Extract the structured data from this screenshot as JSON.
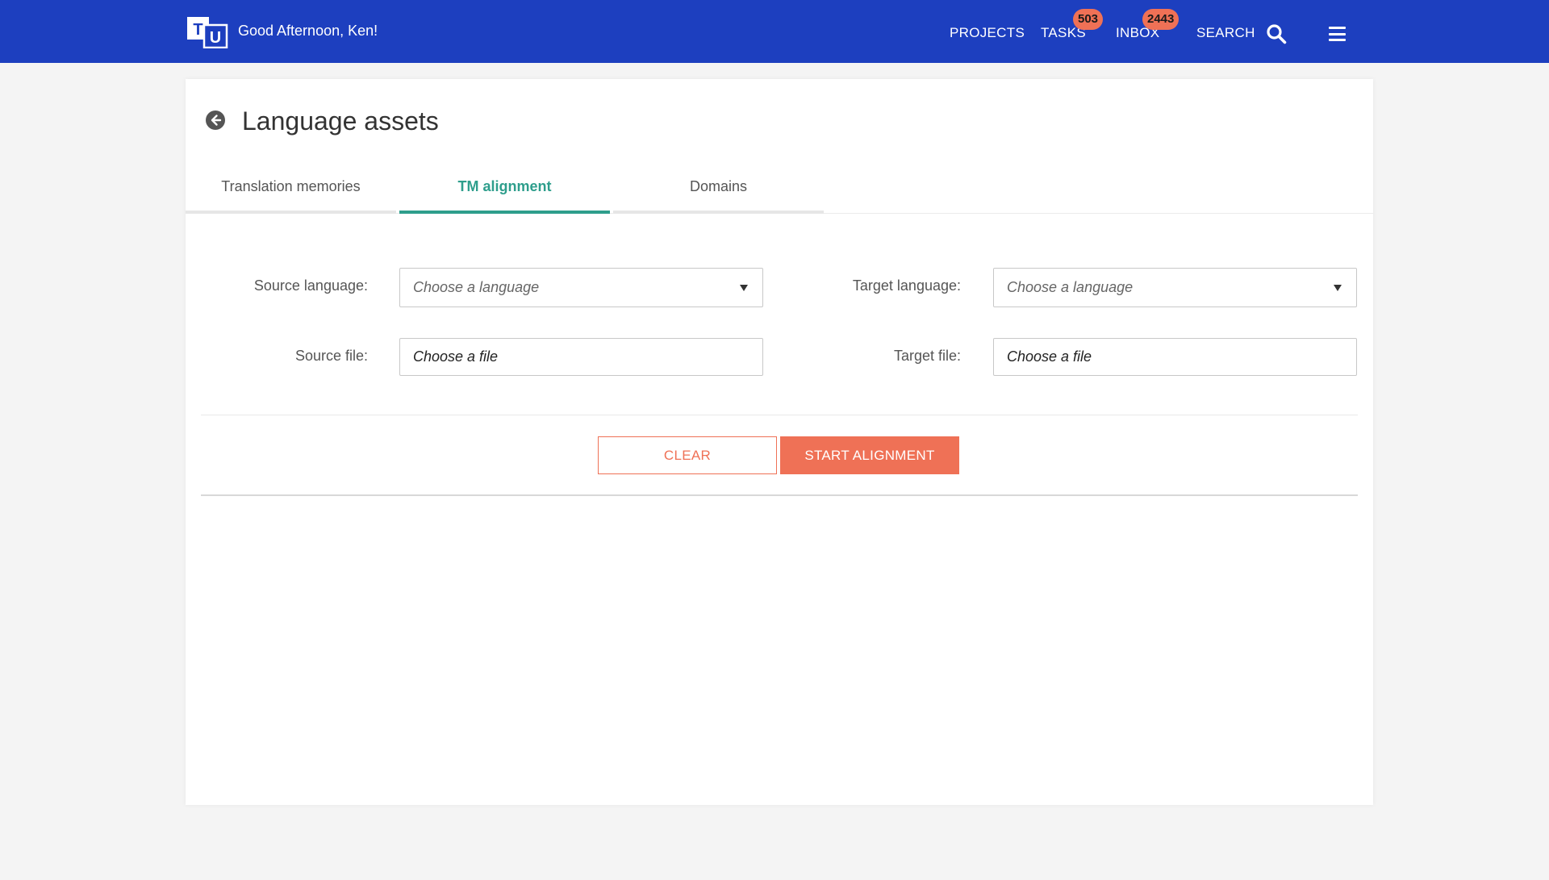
{
  "header": {
    "logo_letters": [
      "T",
      "U"
    ],
    "greeting": "Good Afternoon, Ken!",
    "nav": {
      "projects": "PROJECTS",
      "tasks": "TASKS",
      "tasks_badge": "503",
      "inbox": "INBOX",
      "inbox_badge": "2443",
      "search": "SEARCH"
    },
    "bar_color": "#1d3fbf",
    "badge_color": "#ef7156"
  },
  "page": {
    "title": "Language assets",
    "tabs": [
      {
        "label": "Translation memories",
        "active": false
      },
      {
        "label": "TM alignment",
        "active": true
      },
      {
        "label": "Domains",
        "active": false
      }
    ],
    "accent_color": "#2e9e8c"
  },
  "form": {
    "source_language_label": "Source language:",
    "source_language_placeholder": "Choose a language",
    "target_language_label": "Target language:",
    "target_language_placeholder": "Choose a language",
    "source_file_label": "Source file:",
    "source_file_placeholder": "Choose a file",
    "target_file_label": "Target file:",
    "target_file_placeholder": "Choose a file"
  },
  "actions": {
    "clear_label": "CLEAR",
    "start_label": "START ALIGNMENT",
    "button_color": "#ef7156"
  },
  "icons": [
    "logo-icon",
    "search-icon",
    "menu-icon",
    "back-arrow-icon",
    "chevron-down-icon"
  ]
}
